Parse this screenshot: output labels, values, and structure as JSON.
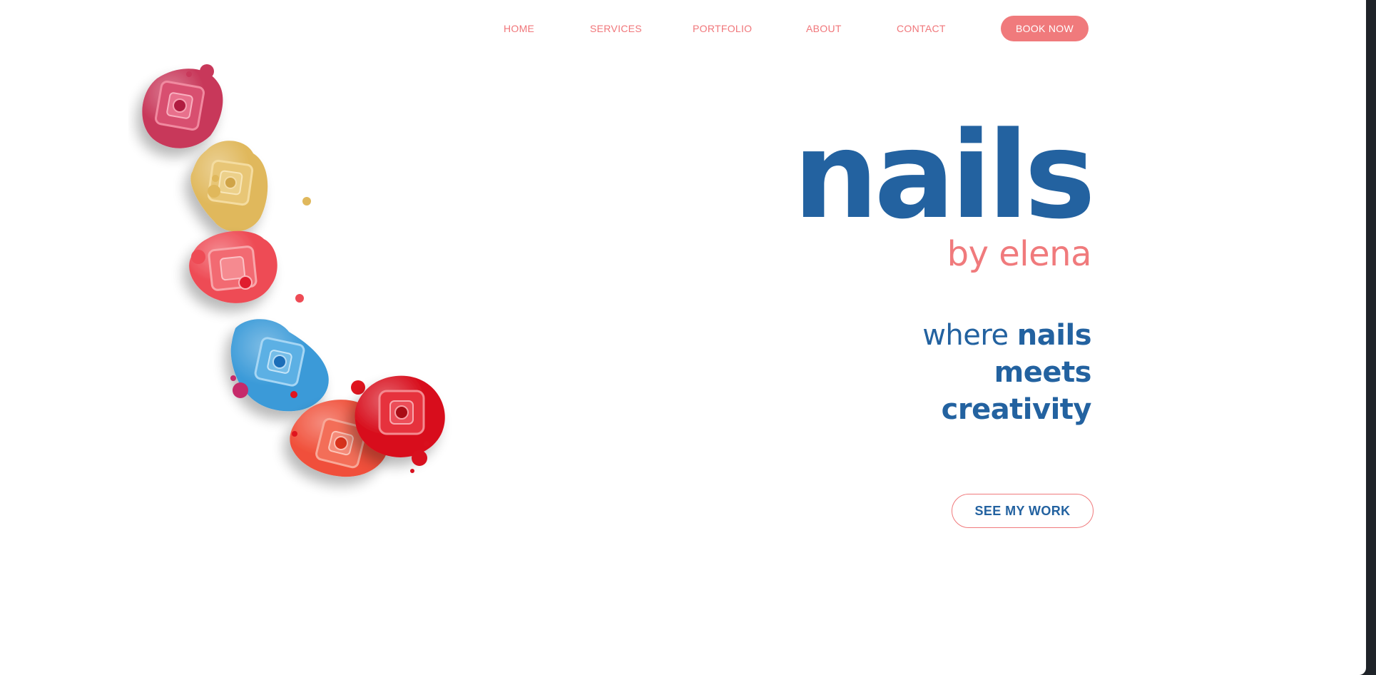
{
  "nav": {
    "items": [
      {
        "label": "HOME"
      },
      {
        "label": "SERVICES"
      },
      {
        "label": "PORTFOLIO"
      },
      {
        "label": "ABOUT"
      },
      {
        "label": "CONTACT"
      }
    ],
    "cta_label": "BOOK NOW"
  },
  "hero": {
    "brand_main": "nails",
    "brand_sub": "by elena",
    "tagline_light": "where",
    "tagline_bold_1": "nails",
    "tagline_bold_2": "meets",
    "tagline_bold_3": "creativity",
    "cta_label": "SEE MY WORK"
  },
  "colors": {
    "accent_coral": "#f07a7c",
    "brand_blue": "#2362a0",
    "background": "#ffffff"
  },
  "artwork": {
    "icon": "nail-polish-bottles-illustration",
    "polish_colors": [
      "#c8385a",
      "#e0b85c",
      "#ee4b55",
      "#3a9ad8",
      "#f0503a",
      "#d8101e"
    ]
  }
}
